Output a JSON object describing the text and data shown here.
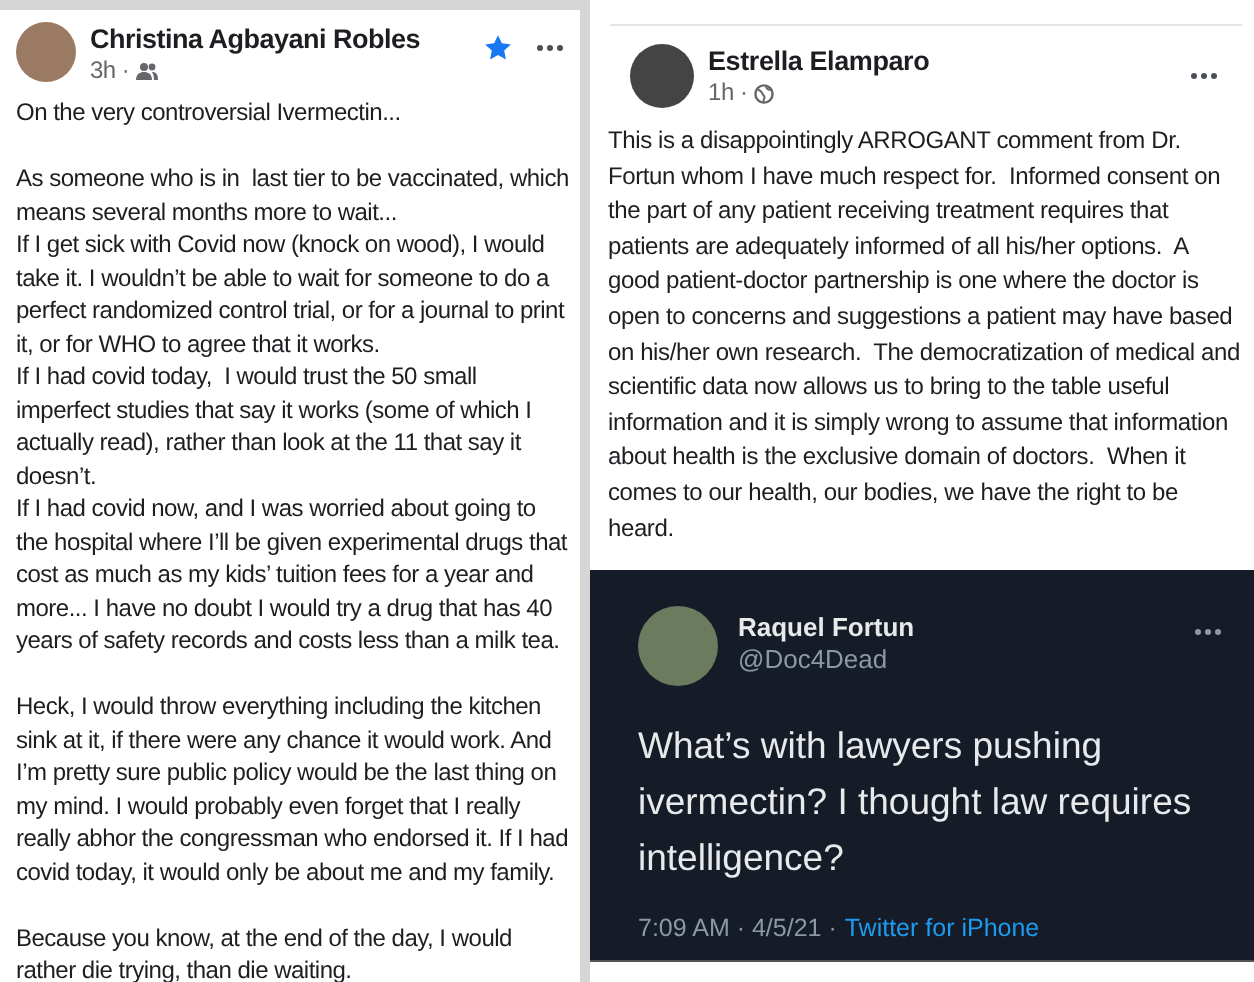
{
  "left_post": {
    "author": "Christina Agbayani Robles",
    "time": "3h",
    "separator": "·",
    "starred": true,
    "sections": [
      {
        "paragraphs": [
          "On the very controversial Ivermectin..."
        ]
      },
      {
        "paragraphs": [
          "As someone who is in  last tier to be vaccinated, which means several months more to wait...",
          "If I get sick with Covid now (knock on wood), I would take it. I wouldn’t be able to wait for someone to do a perfect randomized control trial, or for a journal to print it, or for WHO to agree that it works.",
          "If I had covid today,  I would trust the 50 small imperfect studies that say it works (some of which I actually read), rather than look at the 11 that say it doesn’t.",
          "If I had covid now, and I was worried about going to the hospital where I’ll be given experimental drugs that cost as much as my kids’ tuition fees for a year and more... I have no doubt I would try a drug that has 40 years of safety records and costs less than a milk tea."
        ]
      },
      {
        "paragraphs": [
          "Heck, I would throw everything including the kitchen sink at it, if there were any chance it would work. And I’m pretty sure public policy would be the last thing on my mind. I would probably even forget that I really really abhor the congressman who endorsed it. If I had covid today, it would only be about me and my family."
        ]
      },
      {
        "paragraphs": [
          "Because you know, at the end of the day, I would rather die trying, than die waiting."
        ]
      }
    ]
  },
  "right_post": {
    "author": "Estrella Elamparo",
    "time": "1h",
    "separator": "·",
    "text": "This is a disappointingly ARROGANT comment from Dr. Fortun whom I have much respect for.  Informed consent on the part of any patient receiving treatment requires that patients are adequately informed of all his/her options.  A good patient-doctor partnership is one where the doctor is open to concerns and suggestions a patient may have based on his/her own research.  The democratization of medical and scientific data now allows us to bring to the table useful information and it is simply wrong to assume that information about health is the exclusive domain of doctors.  When it comes to our health, our bodies, we have the right to be heard."
  },
  "tweet": {
    "name": "Raquel Fortun",
    "handle": "@Doc4Dead",
    "text": "What’s with lawyers pushing ivermectin? I thought law requires intelligence?",
    "time": "7:09 AM · 4/5/21 ·",
    "source": "Twitter for iPhone"
  }
}
